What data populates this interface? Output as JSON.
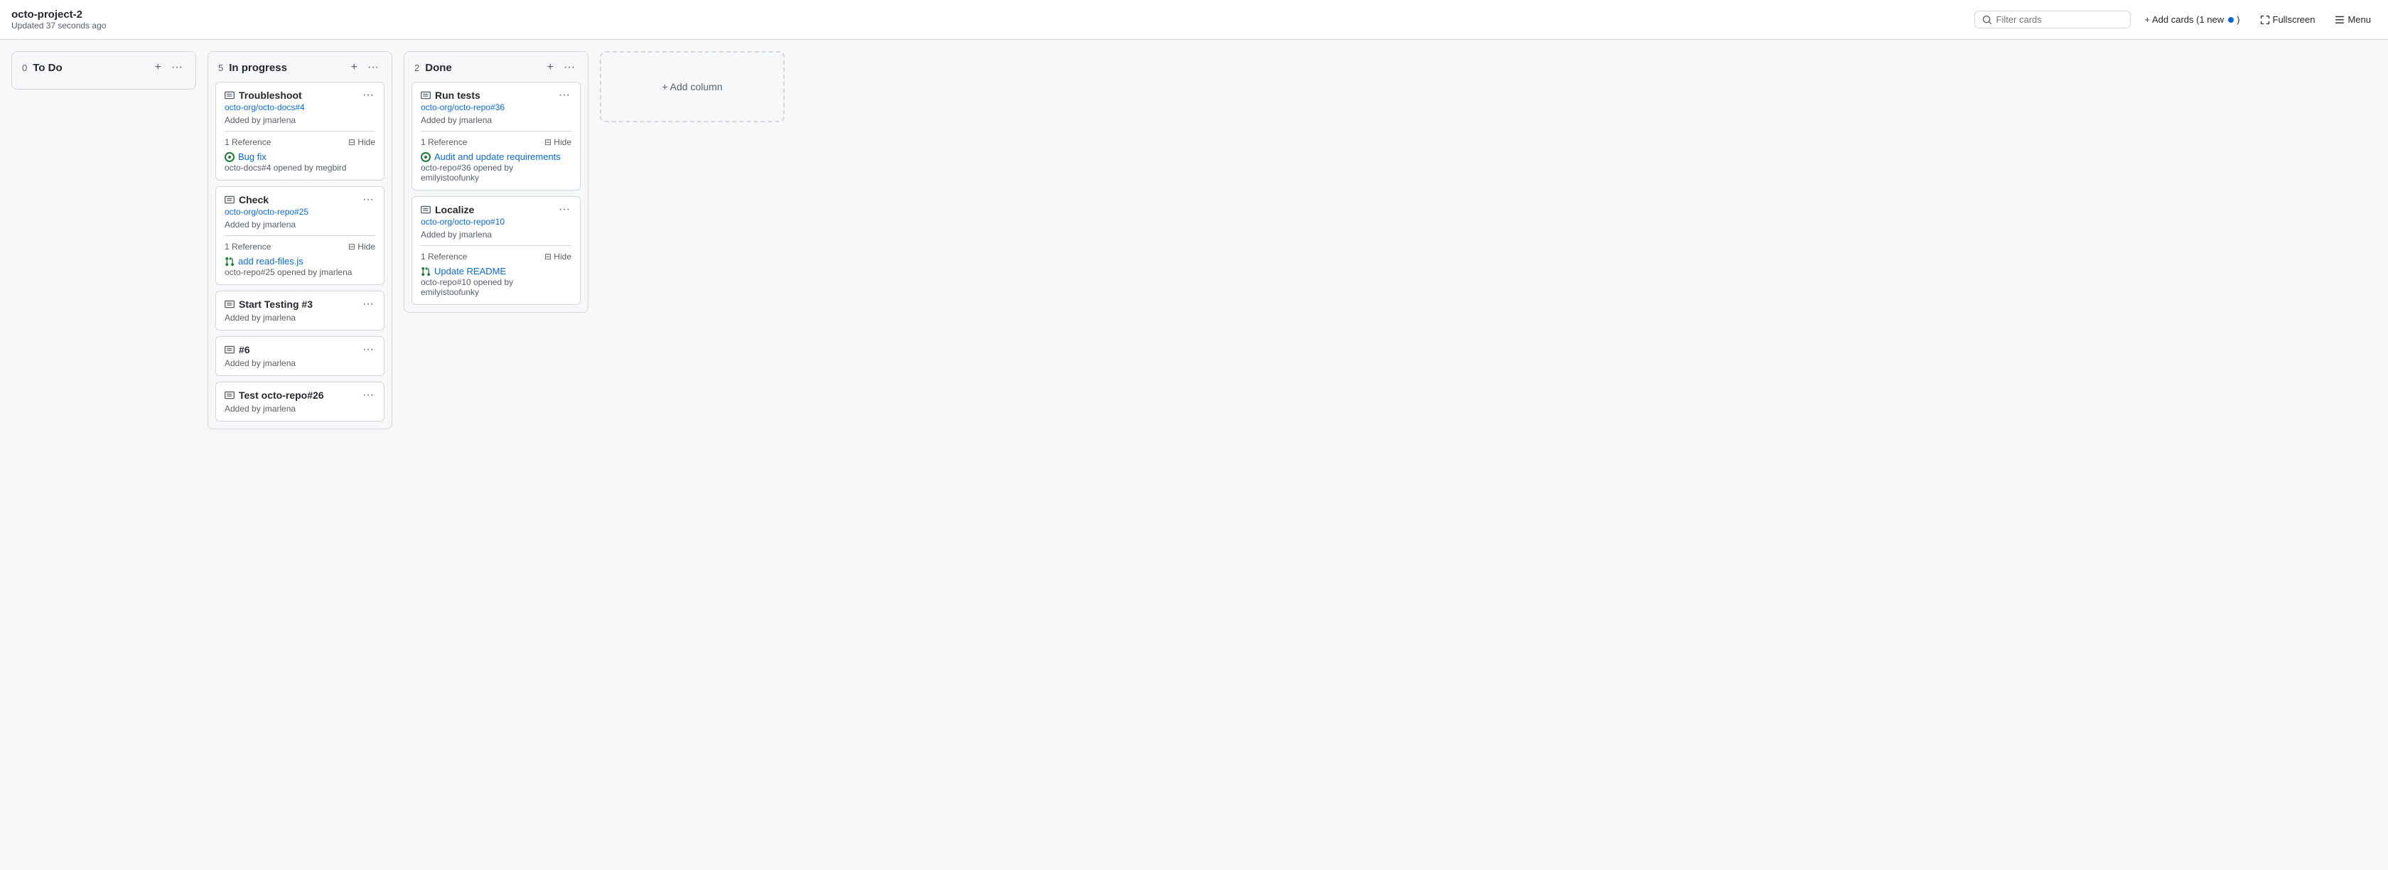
{
  "header": {
    "project_title": "octo-project-2",
    "project_updated": "Updated 37 seconds ago",
    "search_placeholder": "Filter cards",
    "add_cards_label": "+ Add cards (1 new",
    "fullscreen_label": "Fullscreen",
    "menu_label": "Menu"
  },
  "columns": [
    {
      "id": "todo",
      "count": "0",
      "title": "To Do",
      "cards": []
    },
    {
      "id": "inprogress",
      "count": "5",
      "title": "In progress",
      "cards": [
        {
          "id": "card-troubleshoot",
          "type": "note",
          "title": "Troubleshoot",
          "link": "octo-org/octo-docs#4",
          "link_href": "#",
          "added_by": "jmarlena",
          "has_reference": true,
          "reference_count": "1 Reference",
          "issue": {
            "status": "open",
            "title": "Bug fix",
            "link": "octo-docs#4",
            "opened_by": "megbird",
            "icon_type": "issue-open"
          }
        },
        {
          "id": "card-check",
          "type": "note",
          "title": "Check",
          "link": "octo-org/octo-repo#25",
          "link_href": "#",
          "added_by": "jmarlena",
          "has_reference": true,
          "reference_count": "1 Reference",
          "issue": {
            "status": "open",
            "title": "add read-files.js",
            "link": "octo-repo#25",
            "opened_by": "jmarlena",
            "icon_type": "pr-open"
          }
        },
        {
          "id": "card-start-testing",
          "type": "note",
          "title": "Start Testing #3",
          "link": null,
          "added_by": "jmarlena",
          "has_reference": false
        },
        {
          "id": "card-6",
          "type": "note",
          "title": "#6",
          "link": null,
          "added_by": "jmarlena",
          "has_reference": false
        },
        {
          "id": "card-test-octo",
          "type": "note",
          "title": "Test octo-repo#26",
          "link": null,
          "added_by": "jmarlena",
          "has_reference": false
        }
      ]
    },
    {
      "id": "done",
      "count": "2",
      "title": "Done",
      "cards": [
        {
          "id": "card-run-tests",
          "type": "note",
          "title": "Run tests",
          "link": "octo-org/octo-repo#36",
          "link_href": "#",
          "added_by": "jmarlena",
          "has_reference": true,
          "reference_count": "1 Reference",
          "issue": {
            "status": "open",
            "title": "Audit and update requirements",
            "link": "octo-repo#36",
            "opened_by": "emilyistoofunky",
            "icon_type": "issue-open"
          }
        },
        {
          "id": "card-localize",
          "type": "note",
          "title": "Localize",
          "link": "octo-org/octo-repo#10",
          "link_href": "#",
          "added_by": "jmarlena",
          "has_reference": true,
          "reference_count": "1 Reference",
          "issue": {
            "status": "open",
            "title": "Update README",
            "link": "octo-repo#10",
            "opened_by": "emilyistoofunky",
            "icon_type": "pr-open"
          }
        }
      ]
    }
  ],
  "add_column": {
    "label": "+ Add column"
  },
  "icons": {
    "search": "🔍",
    "three_dots": "···",
    "plus": "+",
    "hide": "⊟",
    "note": "📋",
    "fullscreen": "⛶",
    "menu": "☰"
  }
}
